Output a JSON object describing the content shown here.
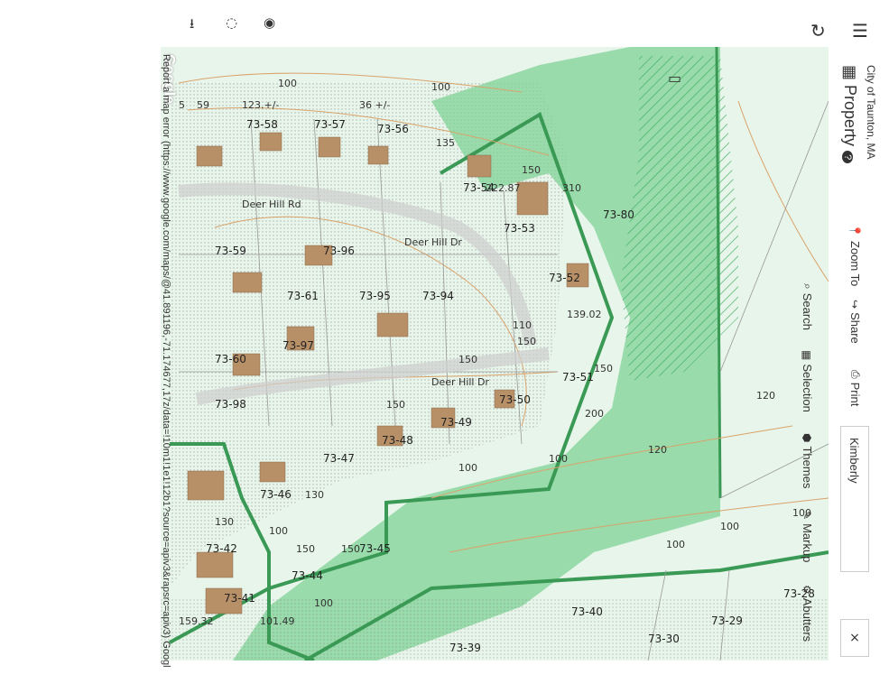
{
  "app": {
    "city": "City of Taunton, MA",
    "title": "Property",
    "help_glyph": "?"
  },
  "toolbar": {
    "zoom_to": "Zoom To",
    "share": "Share",
    "search": "Search",
    "print": "Print",
    "selection": "Selection",
    "themes": "Themes",
    "markup": "Markup",
    "abutters": "Abutters"
  },
  "search_input": {
    "value": "Kimberly"
  },
  "close_label": "×",
  "map": {
    "attribution": "Report a map error (https://www.google.com/maps/@41.891196,-71.174677,17z/data=!10m1!1e1!12b1?source=apiv3&rapsrc=apiv3) Google",
    "google_label": "Google",
    "streets": [
      "Deer Hill Rd",
      "Deer Hill Dr",
      "Deer Hill Dr"
    ],
    "lots": [
      "73-53",
      "73-54",
      "73-52",
      "73-80",
      "73-51",
      "73-50",
      "73-49",
      "73-48",
      "73-47",
      "73-46",
      "73-45",
      "73-44",
      "73-42",
      "73-41",
      "73-40",
      "73-39",
      "73-30",
      "73-29",
      "73-28",
      "73-56",
      "73-57",
      "73-58",
      "73-59",
      "73-60",
      "73-61",
      "73-97",
      "73-98",
      "73-94",
      "73-95",
      "73-96"
    ],
    "contours": [
      "100",
      "100",
      "110",
      "120",
      "120",
      "130",
      "130",
      "100",
      "100"
    ],
    "dims": [
      "150",
      "150",
      "150",
      "150",
      "150",
      "100",
      "100",
      "100",
      "100",
      "150",
      "222.87",
      "310",
      "135",
      "139.02",
      "101.49",
      "159.32",
      "150",
      "100",
      "200",
      "123.+/-",
      "36 +/-",
      "59",
      "5"
    ]
  },
  "icons": {
    "download": "download-icon",
    "lasso": "lasso-icon",
    "compass": "compass-icon",
    "refresh": "refresh-icon",
    "menu": "menu-icon"
  },
  "colors": {
    "zone_green": "#5fc27a",
    "zone_light": "#cfead6",
    "boundary": "#3a9a55",
    "contour": "#d9a36b",
    "building": "#b89068"
  }
}
